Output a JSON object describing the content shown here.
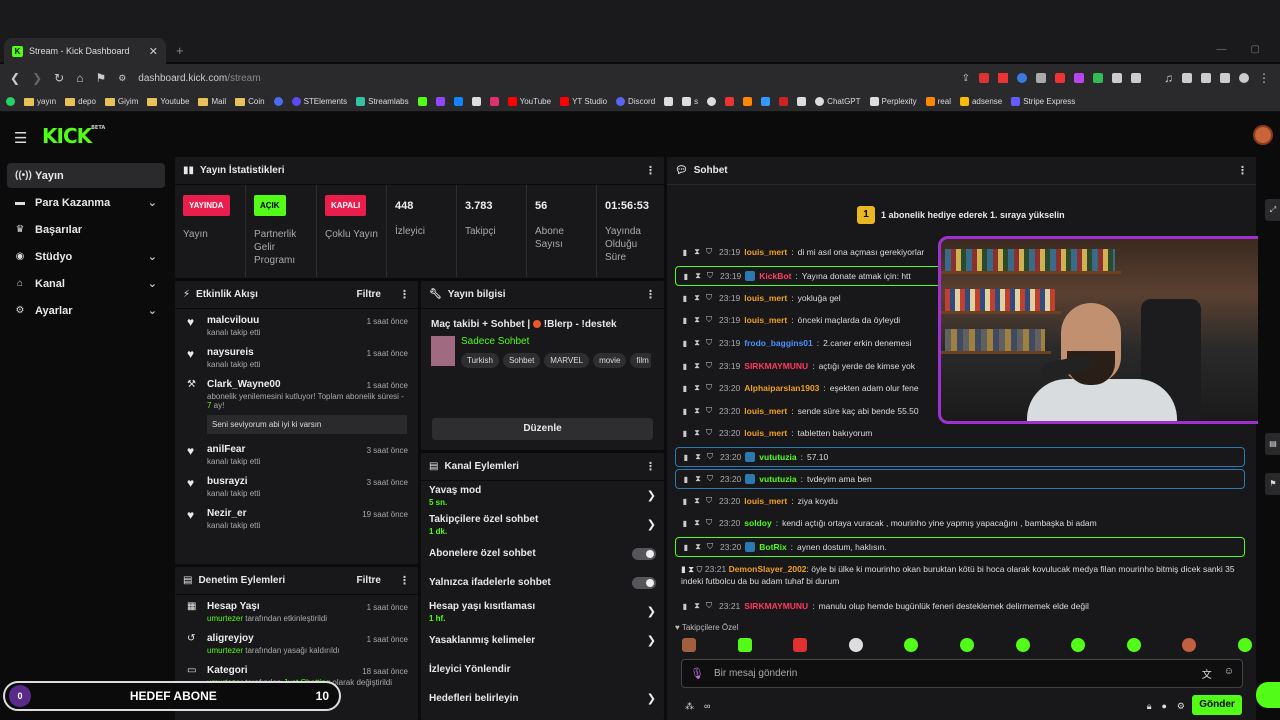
{
  "browser": {
    "tab_title": "Stream - Kick Dashboard",
    "url_host": "dashboard.kick.com",
    "url_path": "/stream",
    "bookmarks": [
      "yayın",
      "depo",
      "Giyim",
      "Youtube",
      "Mail",
      "Coin",
      "STElements",
      "Streamlabs",
      "YouTube",
      "YT Studio",
      "Discord",
      "s",
      "ChatGPT",
      "Perplexity",
      "real",
      "adsense",
      "Stripe Express"
    ]
  },
  "brand": {
    "logo": "KICK",
    "beta": "BETA"
  },
  "sidebar": {
    "items": [
      {
        "label": "Yayın",
        "icon": "broadcast-icon"
      },
      {
        "label": "Para Kazanma",
        "icon": "money-icon"
      },
      {
        "label": "Başarılar",
        "icon": "trophy-icon"
      },
      {
        "label": "Stüdyo",
        "icon": "studio-icon"
      },
      {
        "label": "Kanal",
        "icon": "home-icon"
      },
      {
        "label": "Ayarlar",
        "icon": "gear-icon"
      }
    ]
  },
  "stats": {
    "title": "Yayın İstatistikleri",
    "items": [
      {
        "badge": "YAYINDA",
        "label": "Yayın"
      },
      {
        "badge": "AÇIK",
        "label": "Partnerlik Gelir Programı"
      },
      {
        "badge": "KAPALI",
        "label": "Çoklu Yayın"
      },
      {
        "value": "448",
        "label": "İzleyici"
      },
      {
        "value": "3.783",
        "label": "Takipçi"
      },
      {
        "value": "56",
        "label": "Abone Sayısı"
      },
      {
        "value": "01:56:53",
        "label": "Yayında Olduğu Süre"
      }
    ]
  },
  "activity": {
    "title": "Etkinlik Akışı",
    "filter": "Filtre",
    "items": [
      {
        "name": "malcvilouu",
        "sub": "kanalı takip etti",
        "time": "1 saat önce"
      },
      {
        "name": "naysureis",
        "sub": "kanalı takip etti",
        "time": "1 saat önce"
      },
      {
        "name": "Clark_Wayne00",
        "sub_a": "abonelik yenilemesini kutluyor! Toplam abonelik süresi - ",
        "sub_b": "7",
        "sub_c": " ay!",
        "quote": "Seni seviyorum abi iyi ki varsın",
        "time": "1 saat önce"
      },
      {
        "name": "anilFear",
        "sub": "kanalı takip etti",
        "time": "3 saat önce"
      },
      {
        "name": "busrayzi",
        "sub": "kanalı takip etti",
        "time": "3 saat önce"
      },
      {
        "name": "Nezir_er",
        "sub": "kanalı takip etti",
        "time": "19 saat önce"
      }
    ]
  },
  "moderation": {
    "title": "Denetim Eylemleri",
    "filter": "Filtre",
    "items": [
      {
        "name": "Hesap Yaşı",
        "by": "umurtezer",
        "rest": " tarafından etkinleştirildi",
        "time": "1 saat önce"
      },
      {
        "name": "aligreyjoy",
        "by": "umurtezer",
        "rest": " tarafından yasağı kaldırıldı",
        "time": "1 saat önce"
      },
      {
        "name": "Kategori",
        "by": "umurtezer",
        "rest": " tarafından ",
        "hl": "Just Chatting",
        "rest2": " olarak değiştirildi",
        "time": "18 saat önce"
      }
    ]
  },
  "streaminfo": {
    "title": "Yayın bilgisi",
    "stream_title_a": "Maç takibi + Sohbet | ",
    "stream_title_b": " !Blerp - !destek",
    "category": "Sadece Sohbet",
    "tags": [
      "Turkish",
      "Sohbet",
      "MARVEL",
      "movie",
      "film"
    ],
    "edit": "Düzenle"
  },
  "channel_actions": {
    "title": "Kanal Eylemleri",
    "items": [
      {
        "label": "Yavaş mod",
        "value": "5 sn.",
        "type": "arrow"
      },
      {
        "label": "Takipçilere özel sohbet",
        "value": "1 dk.",
        "type": "arrow"
      },
      {
        "label": "Abonelere özel sohbet",
        "value": "",
        "type": "toggle"
      },
      {
        "label": "Yalnızca ifadelerle sohbet",
        "value": "",
        "type": "toggle"
      },
      {
        "label": "Hesap yaşı kısıtlaması",
        "value": "1 hf.",
        "type": "arrow"
      },
      {
        "label": "Yasaklanmış kelimeler",
        "value": "",
        "type": "arrow"
      },
      {
        "label": "İzleyici Yönlendir",
        "value": "",
        "type": "none"
      },
      {
        "label": "Hedefleri belirleyin",
        "value": "",
        "type": "arrow"
      }
    ]
  },
  "chat": {
    "title": "Sohbet",
    "gift_count": "1",
    "gift_text": "1 abonelik hediye ederek 1. sıraya yükselin",
    "messages": [
      {
        "time": "23:19",
        "user": "louis_mert",
        "color": "#f0a020",
        "text": "di mi asıl ona açması gerekiyorlar"
      },
      {
        "time": "23:19",
        "user": "KickBot",
        "color": "#ff4060",
        "text": "Yayına donate atmak için: htt",
        "box": "#53fc18"
      },
      {
        "time": "23:19",
        "user": "louis_mert",
        "color": "#f0a020",
        "text": "yokluğa gel"
      },
      {
        "time": "23:19",
        "user": "louis_mert",
        "color": "#f0a020",
        "text": "önceki maçlarda da öyleydi"
      },
      {
        "time": "23:19",
        "user": "frodo_baggins01",
        "color": "#4a90ff",
        "text": "2.caner erkin denemesi"
      },
      {
        "time": "23:19",
        "user": "SIRKMAYMUNU",
        "color": "#ff3a5a",
        "text": "açtığı yerde de kimse yok"
      },
      {
        "time": "23:20",
        "user": "Alphaiparslan1903",
        "color": "#f0a020",
        "text": "eşekten adam olur fene"
      },
      {
        "time": "23:20",
        "user": "louis_mert",
        "color": "#f0a020",
        "text": "sende süre kaç abi bende 55.50"
      },
      {
        "time": "23:20",
        "user": "louis_mert",
        "color": "#f0a020",
        "text": "tabletten bakıyorum"
      },
      {
        "time": "23:20",
        "user": "vututuzia",
        "color": "#53fc18",
        "text": "57.10",
        "box": "#2a7ab0"
      },
      {
        "time": "23:20",
        "user": "vututuzia",
        "color": "#53fc18",
        "text": "tvdeyim ama ben",
        "box": "#2a7ab0"
      },
      {
        "time": "23:20",
        "user": "louis_mert",
        "color": "#f0a020",
        "text": "ziya koydu"
      },
      {
        "time": "23:20",
        "user": "soldoy",
        "color": "#53fc18",
        "text": "kendi açtığı ortaya vuracak , mourinho yine yapmış yapacağını , bambaşka bi adam"
      },
      {
        "time": "23:20",
        "user": "BotRix",
        "color": "#53fc18",
        "text": "aynen dostum, haklısın.",
        "box": "#53fc18"
      }
    ],
    "long_message": {
      "time": "23:21",
      "user": "DemonSlayer_2002",
      "text": "öyle bi ülke ki mourinho okan buruktan kötü bi hoca olarak kovulucak medya filan mourinho bitmiş dicek sanki 35 indeki futbolcu da bu adam tuhaf bi durum"
    },
    "last_message": {
      "time": "23:21",
      "user": "SIRKMAYMUNU",
      "text": "manulu olup hemde bugünlük feneri desteklemek delirmemek elde değil"
    },
    "followers_only": "Takipçilere Özel",
    "input_placeholder": "Bir mesaj gönderin",
    "send": "Gönder"
  },
  "goal": {
    "left": "0",
    "label": "HEDEF ABONE",
    "right": "10"
  },
  "colors": {
    "accent": "#53fc18",
    "live": "#e91e4d",
    "webcam_border": "#a030d0"
  }
}
